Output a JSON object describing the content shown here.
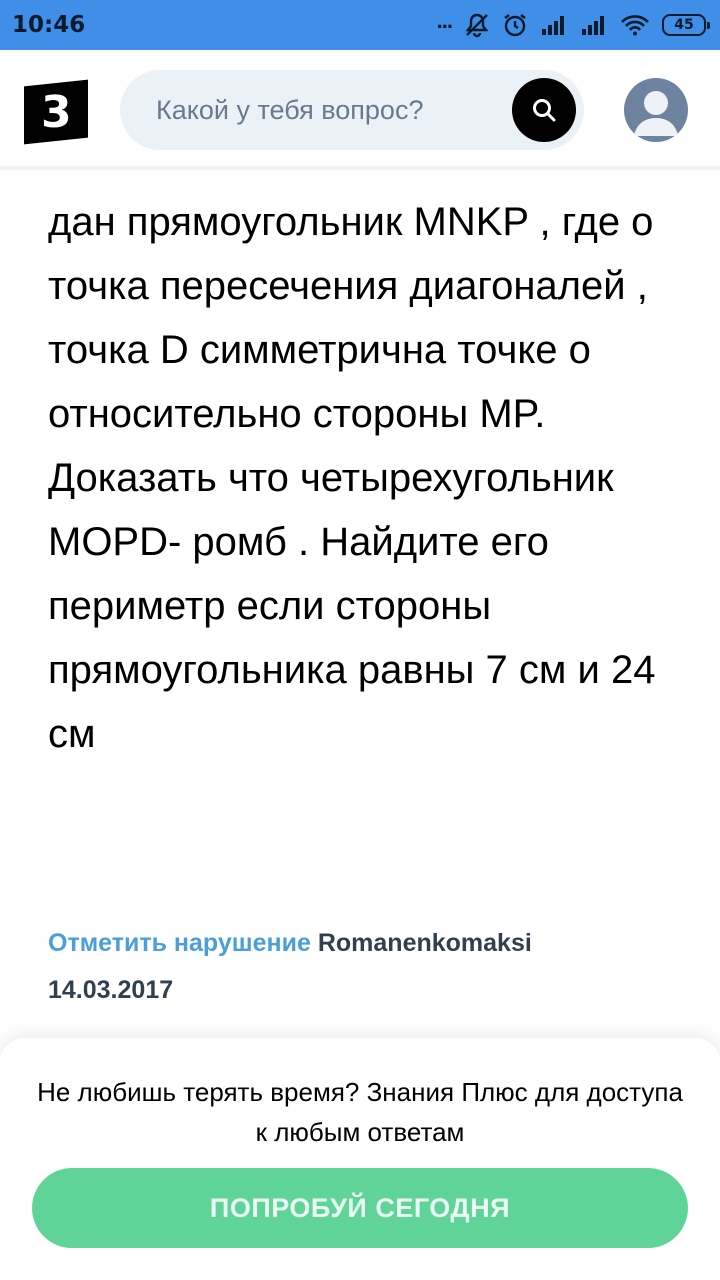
{
  "status_bar": {
    "time": "10:46",
    "dots": "...",
    "battery": "45",
    "bg_color": "#3f8fe8"
  },
  "header": {
    "logo_text": "3",
    "search": {
      "placeholder": "Какой у тебя вопрос?"
    },
    "search_icon": "search-icon",
    "avatar_icon": "user-avatar-icon"
  },
  "question": {
    "text": "дан прямоугольник MNKP , где о точка пересечения диагоналей , точка D симметрична точке о относительно стороны MP. Доказать что четырехугольник MOPD- ромб . Найдите его периметр если стороны прямоугольника равны 7 см и 24 см",
    "report_label": "Отметить нарушение",
    "author": "Romanenkomaksi",
    "date": "14.03.2017",
    "link_color": "#4a9fd8"
  },
  "promo": {
    "text": "Не любишь терять время? Знания Плюс для доступа к любым ответам",
    "button_label": "ПОПРОБУЙ СЕГОДНЯ",
    "button_color": "#60d399"
  }
}
